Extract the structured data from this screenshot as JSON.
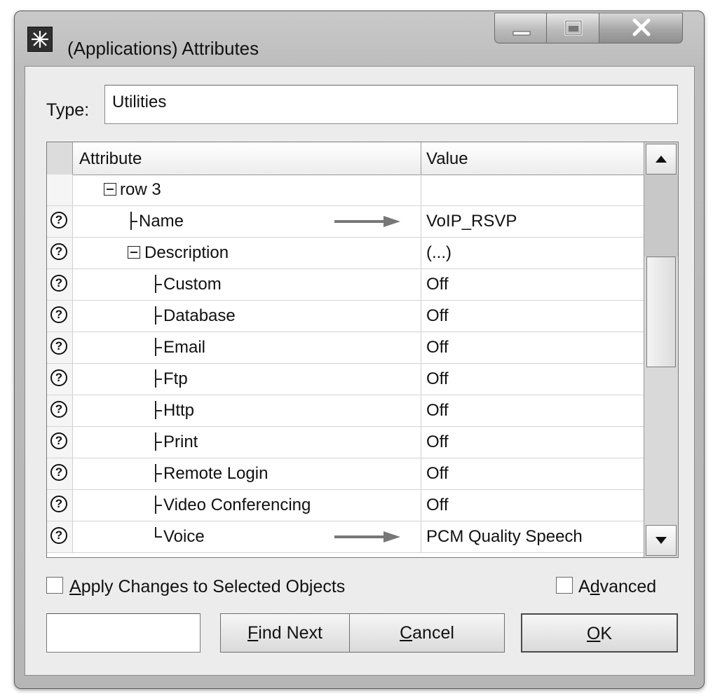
{
  "window": {
    "title": "(Applications) Attributes",
    "app_icon": "starburst-icon",
    "controls": [
      "minimize",
      "maximize",
      "close"
    ]
  },
  "type_field": {
    "label": "Type:",
    "value": "Utilities"
  },
  "table": {
    "columns": {
      "attribute": "Attribute",
      "value": "Value"
    },
    "rows": [
      {
        "name": "row 3",
        "value": "",
        "help": false,
        "expander": "minus"
      },
      {
        "name": "Name",
        "value": "VoIP_RSVP",
        "help": true,
        "arrow": true
      },
      {
        "name": "Description",
        "value": "(...)",
        "help": true,
        "expander": "minus"
      },
      {
        "name": "Custom",
        "value": "Off",
        "help": true
      },
      {
        "name": "Database",
        "value": "Off",
        "help": true
      },
      {
        "name": "Email",
        "value": "Off",
        "help": true
      },
      {
        "name": "Ftp",
        "value": "Off",
        "help": true
      },
      {
        "name": "Http",
        "value": "Off",
        "help": true
      },
      {
        "name": "Print",
        "value": "Off",
        "help": true
      },
      {
        "name": "Remote Login",
        "value": "Off",
        "help": true
      },
      {
        "name": "Video Conferencing",
        "value": "Off",
        "help": true
      },
      {
        "name": "Voice",
        "value": "PCM Quality Speech",
        "help": true,
        "arrow": true
      }
    ],
    "help_glyph": "?"
  },
  "options": {
    "apply_changes": {
      "label": "Apply Changes to Selected Objects",
      "checked": false
    },
    "advanced": {
      "label_pre": "A",
      "label_ul": "d",
      "label_post": "vanced",
      "checked": false
    }
  },
  "buttons": {
    "find_next": {
      "ul": "F",
      "rest": "ind Next"
    },
    "cancel": {
      "ul": "C",
      "rest": "ancel"
    },
    "ok": {
      "ul": "O",
      "rest": "K"
    }
  }
}
